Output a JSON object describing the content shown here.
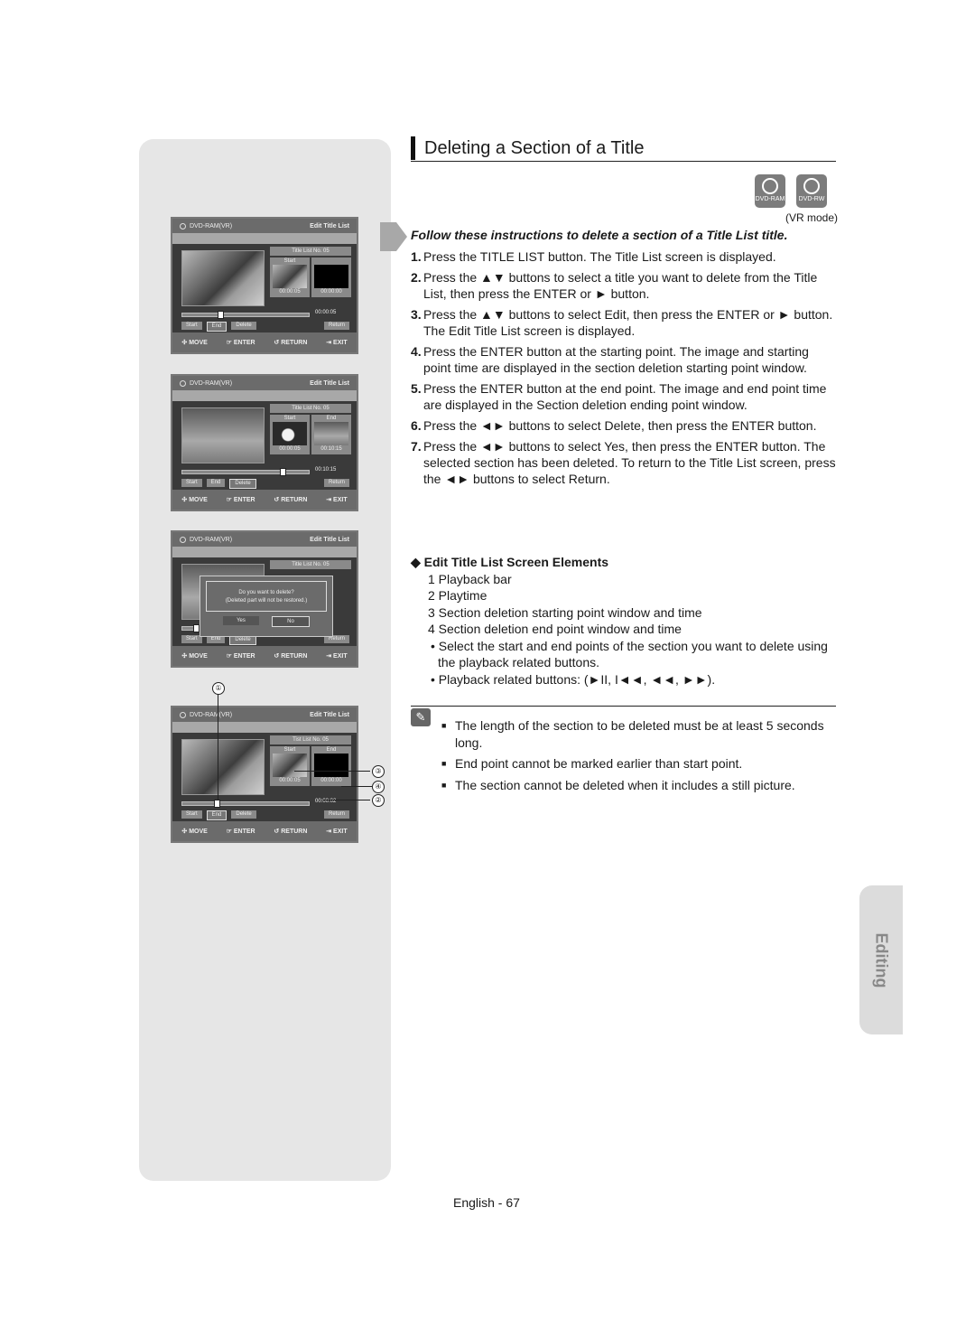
{
  "page": {
    "title": "Deleting a Section of a Title",
    "mode_note": "(VR mode)",
    "disc_icons": [
      {
        "icon": "dvd-ram-disc-icon",
        "label": "DVD-RAM"
      },
      {
        "icon": "dvd-rw-disc-icon",
        "label": "DVD-RW"
      }
    ],
    "intro": "Follow these instructions to delete a section of a Title List title.",
    "steps": [
      {
        "num": "1.",
        "text": "Press the TITLE LIST button. The Title List screen is displayed."
      },
      {
        "num": "2.",
        "text": "Press the ▲▼ buttons to select a title you want to delete from the Title List, then press the ENTER or ► button."
      },
      {
        "num": "3.",
        "text": "Press the ▲▼ buttons to select Edit, then press the ENTER or ► button. The Edit Title List screen is displayed."
      },
      {
        "num": "4.",
        "text": "Press the ENTER button at the starting point. The image and starting point time are displayed in the section deletion starting point window."
      },
      {
        "num": "5.",
        "text": "Press the ENTER button at the end point. The image and end point time are displayed in the Section deletion ending point window."
      },
      {
        "num": "6.",
        "text": "Press the ◄► buttons to select Delete, then press the ENTER button."
      },
      {
        "num": "7.",
        "text": "Press the ◄► buttons to select Yes, then press the ENTER button. The selected section has been deleted. To return to the Title List screen, press the ◄► buttons to select Return."
      }
    ],
    "elements": {
      "heading": "◆ Edit Title List Screen Elements",
      "items": [
        "1 Playback bar",
        "2 Playtime",
        "3 Section deletion starting point window and time",
        "4 Section deletion end point window and time"
      ],
      "bullets": [
        "• Select the start and end points of the section you want to delete using the playback related buttons.",
        "• Playback related buttons: (►II, I◄◄, ◄◄, ►►)."
      ]
    },
    "notes": [
      "The length of the section to be deleted must be at least 5 seconds long.",
      "End point cannot be marked earlier than start point.",
      "The section cannot be deleted when it includes a still picture."
    ],
    "note_icon": "pencil-note-icon",
    "side_tab": "Editing",
    "page_number": "English - 67"
  },
  "screens": [
    {
      "source": "DVD-RAM(VR)",
      "title": "Edit Title List",
      "title_list_no": "Title List No. 05",
      "start_label": "Start",
      "end_label": "",
      "start_time": "00:00:05",
      "end_time": "00:00:00",
      "current_time": "00:00:05",
      "progress": 0.3,
      "selected_button": "End",
      "image": "dolphin"
    },
    {
      "source": "DVD-RAM(VR)",
      "title": "Edit Title List",
      "title_list_no": "Title List No. 05",
      "start_label": "Start",
      "end_label": "End",
      "start_time": "00:00:05",
      "end_time": "00:10:15",
      "current_time": "00:10:15",
      "progress": 0.8,
      "selected_button": "Delete",
      "image": "field"
    },
    {
      "source": "DVD-RAM(VR)",
      "title": "Edit Title List",
      "title_list_no": "Title List No. 05",
      "dialog": {
        "line1": "Do you want to delete?",
        "line2": "(Deleted part will not be restored.)",
        "yes": "Yes",
        "no": "No"
      },
      "current_time": ":20",
      "selected_button": "Delete",
      "image": "field"
    },
    {
      "source": "DVD-RAM(VR)",
      "title": "Edit Title List",
      "title_list_no": "Tist List No. 05",
      "start_label": "Start",
      "end_label": "End",
      "start_time": "00:00:05",
      "end_time": "00:00:00",
      "current_time": "00:00:02",
      "progress": 0.27,
      "selected_button": "End",
      "image": "dolphin"
    }
  ],
  "screen_buttons": [
    "Start",
    "End",
    "Delete",
    "Return"
  ],
  "screen_footer": [
    {
      "icon": "move-icon",
      "glyph": "✣",
      "label": "MOVE"
    },
    {
      "icon": "enter-icon",
      "glyph": "☞",
      "label": "ENTER"
    },
    {
      "icon": "return-icon",
      "glyph": "↺",
      "label": "RETURN"
    },
    {
      "icon": "exit-icon",
      "glyph": "⇥",
      "label": "EXIT"
    }
  ],
  "callouts": [
    "①",
    "②",
    "③",
    "④"
  ]
}
